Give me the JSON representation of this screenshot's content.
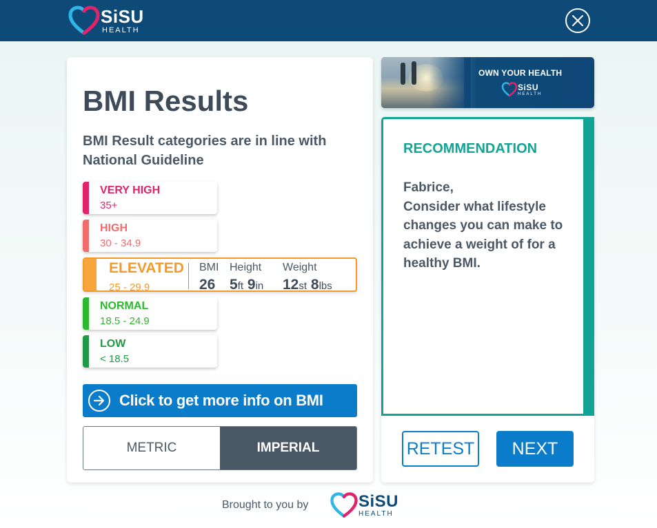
{
  "header": {
    "brand_name": "SiSU",
    "brand_sub": "HEALTH",
    "close_icon": "close-icon"
  },
  "bmi_card": {
    "title": "BMI Results",
    "subtitle": "BMI Result categories are in line with National Guideline",
    "categories": [
      {
        "name": "VERY HIGH",
        "range": "35+",
        "color": "#e0246a"
      },
      {
        "name": "HIGH",
        "range": "30 - 34.9",
        "color": "#f26b6b"
      },
      {
        "name": "ELEVATED",
        "range": "25 - 29.9",
        "color": "#f39a2a"
      },
      {
        "name": "NORMAL",
        "range": "18.5 - 24.9",
        "color": "#2cb82c"
      },
      {
        "name": "LOW",
        "range": "< 18.5",
        "color": "#1e9a45"
      }
    ],
    "result": {
      "bmi_label": "BMI",
      "bmi_value": "26",
      "height_label": "Height",
      "height_ft": "5",
      "height_ft_unit": "ft",
      "height_in": "9",
      "height_in_unit": "in",
      "weight_label": "Weight",
      "weight_st": "12",
      "weight_st_unit": "st",
      "weight_lbs": "8",
      "weight_lbs_unit": "lbs"
    },
    "info_button": "Click to get more info on BMI",
    "units_toggle": {
      "metric": "METRIC",
      "imperial": "IMPERIAL",
      "selected": "IMPERIAL"
    }
  },
  "banner": {
    "tagline": "OWN YOUR HEALTH",
    "brand_name": "SiSU",
    "brand_sub": "HEALTH"
  },
  "recommendation": {
    "title": "RECOMMENDATION",
    "name_line": "Fabrice,",
    "body": "Consider what lifestyle changes you can make to achieve a weight of for a healthy BMI.",
    "retest_label": "RETEST",
    "next_label": "NEXT"
  },
  "footer": {
    "text": "Brought to you by",
    "brand_name": "SiSU",
    "brand_sub": "HEALTH"
  },
  "colors": {
    "header_bg": "#0d4a78",
    "accent_blue": "#0a7cc9",
    "teal": "#12a394",
    "heart_pink": "#e0246a",
    "heart_blue": "#2fb5e8"
  }
}
